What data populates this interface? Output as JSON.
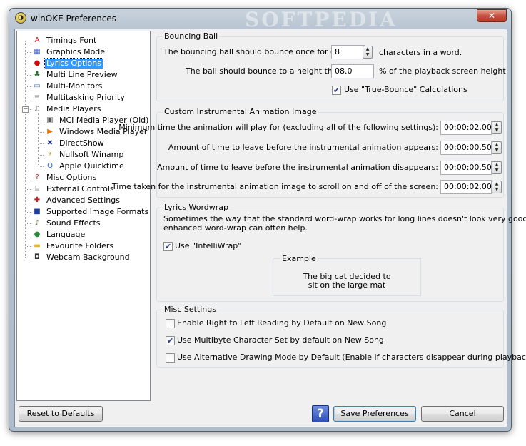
{
  "window": {
    "title": "winOKE Preferences",
    "app_icon_glyph": "◑",
    "watermark": "SOFTPEDIA",
    "close_glyph": "✕"
  },
  "tree": {
    "items": [
      {
        "label": "Timings Font",
        "icon": "font-icon",
        "glyph": "A",
        "color": "#c81e1e"
      },
      {
        "label": "Graphics Mode",
        "icon": "graphics-icon",
        "glyph": "▦",
        "color": "#3c5ad2"
      },
      {
        "label": "Lyrics Options",
        "icon": "lyrics-icon",
        "glyph": "●",
        "color": "#c80e0e",
        "selected": true
      },
      {
        "label": "Multi Line Preview",
        "icon": "preview-icon",
        "glyph": "♣",
        "color": "#2a6e2a"
      },
      {
        "label": "Multi-Monitors",
        "icon": "monitor-icon",
        "glyph": "▭",
        "color": "#3a79c8"
      },
      {
        "label": "Multitasking Priority",
        "icon": "priority-icon",
        "glyph": "≡",
        "color": "#666666"
      },
      {
        "label": "Media Players",
        "icon": "media-icon",
        "glyph": "♫",
        "color": "#444444"
      },
      {
        "label": "MCI Media Player (Old)",
        "icon": "mci-icon",
        "glyph": "▣",
        "color": "#555555"
      },
      {
        "label": "Windows Media Player",
        "icon": "wmp-icon",
        "glyph": "▶",
        "color": "#e07a10"
      },
      {
        "label": "DirectShow",
        "icon": "directshow-icon",
        "glyph": "✖",
        "color": "#1e2a7a"
      },
      {
        "label": "Nullsoft Winamp",
        "icon": "winamp-icon",
        "glyph": "⚡",
        "color": "#d08a10"
      },
      {
        "label": "Apple Quicktime",
        "icon": "quicktime-icon",
        "glyph": "Q",
        "color": "#2a66c8"
      },
      {
        "label": "Misc Options",
        "icon": "question-icon",
        "glyph": "?",
        "color": "#c81e1e"
      },
      {
        "label": "External Controls",
        "icon": "controls-icon",
        "glyph": "⌸",
        "color": "#777777"
      },
      {
        "label": "Advanced Settings",
        "icon": "plus-icon",
        "glyph": "✚",
        "color": "#d01818"
      },
      {
        "label": "Supported Image Formats",
        "icon": "image-icon",
        "glyph": "■",
        "color": "#1e3ca0"
      },
      {
        "label": "Sound Effects",
        "icon": "speaker-icon",
        "glyph": "♪",
        "color": "#6a6a2a"
      },
      {
        "label": "Language",
        "icon": "globe-icon",
        "glyph": "●",
        "color": "#2a8a3a"
      },
      {
        "label": "Favourite Folders",
        "icon": "folder-icon",
        "glyph": "▬",
        "color": "#e0b830"
      },
      {
        "label": "Webcam Background",
        "icon": "webcam-icon",
        "glyph": "◘",
        "color": "#333333"
      }
    ]
  },
  "bouncing_ball": {
    "title": "Bouncing Ball",
    "bounce_prefix": "The bouncing ball should bounce once for every",
    "bounce_value": "8",
    "bounce_suffix": "characters in a word.",
    "height_prefix": "The ball should bounce to a height that is",
    "height_value": "08.0",
    "height_suffix": "% of the playback screen height",
    "true_bounce_label": "Use \"True-Bounce\" Calculations",
    "true_bounce_checked": true
  },
  "instrumental": {
    "title": "Custom Instrumental Animation Image",
    "rows": [
      {
        "label": "Minimum time the animation will play for (excluding all of the following settings):",
        "value": "00:00:02.000"
      },
      {
        "label": "Amount of time to leave before the instrumental animation appears:",
        "value": "00:00:00.500"
      },
      {
        "label": "Amount of time to leave before the instrumental animation disappears:",
        "value": "00:00:00.500"
      },
      {
        "label": "Time taken for the instrumental animation image to scroll on and off of the screen:",
        "value": "00:00:02.000"
      }
    ]
  },
  "wordwrap": {
    "title": "Lyrics Wordwrap",
    "description_line1": "Sometimes the way that the standard word-wrap works for long lines doesn't look very good. This",
    "description_line2": "enhanced word-wrap can often help.",
    "intelliwrap_label": "Use \"IntelliWrap\"",
    "intelliwrap_checked": true,
    "example_title": "Example",
    "example_line1": "The big cat decided to",
    "example_line2": "sit on the large mat"
  },
  "misc": {
    "title": "Misc Settings",
    "options": [
      {
        "label": "Enable Right to Left Reading by Default on New Song",
        "checked": false
      },
      {
        "label": "Use Multibyte Character Set by default on New Song",
        "checked": true
      },
      {
        "label": "Use Alternative Drawing Mode by Default (Enable if characters disappear during playback)",
        "checked": false
      }
    ]
  },
  "buttons": {
    "reset": "Reset to Defaults",
    "help_glyph": "?",
    "save": "Save Preferences",
    "cancel": "Cancel"
  },
  "glyphs": {
    "check": "✔",
    "spin_up": "▲",
    "spin_down": "▼",
    "expand_minus": "−"
  }
}
